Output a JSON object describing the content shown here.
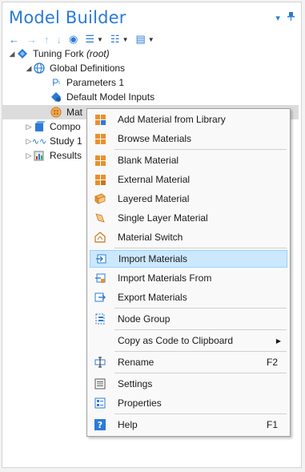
{
  "window": {
    "title": "Model Builder",
    "controls": [
      {
        "icon": "dropdown-icon",
        "glyph": "▾"
      },
      {
        "icon": "pin-icon",
        "glyph": "⊥"
      }
    ]
  },
  "toolbar": {
    "items": [
      {
        "name": "back-arrow-icon",
        "glyph": "←"
      },
      {
        "name": "forward-arrow-icon",
        "glyph": "→"
      },
      {
        "name": "up-arrow-icon",
        "glyph": "↑"
      },
      {
        "name": "down-arrow-icon",
        "glyph": "↓"
      },
      {
        "name": "show-icon",
        "glyph": "◉"
      },
      {
        "name": "expand-tree-icon",
        "glyph": "☰"
      },
      {
        "name": "collapse-tree-icon",
        "glyph": "☷"
      },
      {
        "name": "model-tree-icon",
        "glyph": "▤"
      }
    ]
  },
  "tree": {
    "root": "Tuning Fork",
    "root_suffix": "(root)",
    "global_definitions": "Global Definitions",
    "parameters": "Parameters 1",
    "default_inputs": "Default Model Inputs",
    "materials": "Mat",
    "component": "Compo",
    "study": "Study 1",
    "results": "Results"
  },
  "menu": {
    "items": [
      {
        "label": "Add Material from Library",
        "icon": "add-material-library-icon",
        "shortcut": ""
      },
      {
        "label": "Browse Materials",
        "icon": "browse-materials-icon",
        "shortcut": ""
      },
      {
        "label": "Blank Material",
        "icon": "blank-material-icon",
        "shortcut": ""
      },
      {
        "label": "External Material",
        "icon": "external-material-icon",
        "shortcut": ""
      },
      {
        "label": "Layered Material",
        "icon": "layered-material-icon",
        "shortcut": ""
      },
      {
        "label": "Single Layer Material",
        "icon": "single-layer-material-icon",
        "shortcut": ""
      },
      {
        "label": "Material Switch",
        "icon": "material-switch-icon",
        "shortcut": ""
      },
      {
        "label": "Import Materials",
        "icon": "import-materials-icon",
        "shortcut": ""
      },
      {
        "label": "Import Materials From",
        "icon": "import-materials-from-icon",
        "shortcut": ""
      },
      {
        "label": "Export Materials",
        "icon": "export-materials-icon",
        "shortcut": ""
      },
      {
        "label": "Node Group",
        "icon": "node-group-icon",
        "shortcut": ""
      },
      {
        "label": "Copy as Code to Clipboard",
        "icon": "",
        "shortcut": ""
      },
      {
        "label": "Rename",
        "icon": "rename-icon",
        "shortcut": "F2"
      },
      {
        "label": "Settings",
        "icon": "settings-icon",
        "shortcut": ""
      },
      {
        "label": "Properties",
        "icon": "properties-icon",
        "shortcut": ""
      },
      {
        "label": "Help",
        "icon": "help-icon",
        "shortcut": "F1"
      }
    ],
    "highlighted": "Import Materials",
    "accent_color": "#2b7bd6",
    "material_color": "#e8912d"
  }
}
